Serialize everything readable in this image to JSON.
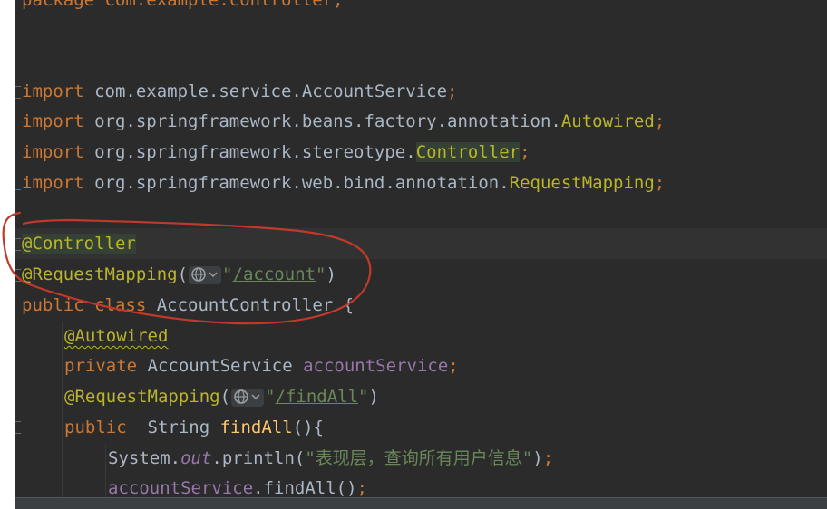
{
  "code": {
    "line_package": "package com.example.controller;",
    "import1": {
      "kw": "import",
      "path": " com.example.service.",
      "cls": "AccountService",
      "semi": ";"
    },
    "import2": {
      "kw": "import",
      "path": " org.springframework.beans.factory.annotation.",
      "cls": "Autowired",
      "semi": ";"
    },
    "import3": {
      "kw": "import",
      "path": " org.springframework.stereotype.",
      "cls": "Controller",
      "semi": ";"
    },
    "import4": {
      "kw": "import",
      "path": " org.springframework.web.bind.annotation.",
      "cls": "RequestMapping",
      "semi": ";"
    },
    "ann_controller": "@Controller",
    "ann_reqmap": "@RequestMapping",
    "paren_open": "(",
    "paren_close": ")",
    "quote": "\"",
    "url_account": "/account",
    "class_decl": {
      "public": "public",
      "class": "class",
      "name": " AccountController ",
      "brace": "{"
    },
    "ann_autowired": "@Autowired",
    "field_decl": {
      "private": "private",
      "type": " AccountService ",
      "name": "accountService",
      "semi": ";"
    },
    "url_findall": "/findAll",
    "method_decl": {
      "public": "public",
      "type": "  String ",
      "name": "findAll",
      "parens": "(){"
    },
    "println": {
      "obj": "System.",
      "field": "out",
      "call": ".println(",
      "str": "\"表现层，查询所有用户信息\"",
      "end": ")",
      "semi": ";"
    },
    "service_call": {
      "field": "accountService",
      "call": ".findAll()",
      "semi": ";"
    }
  },
  "icons": {
    "web": "globe-icon",
    "dropdown": "chevron-down-icon"
  },
  "colors": {
    "background": "#2b2b2b",
    "keyword": "#cc7832",
    "annotation": "#bbb529",
    "string": "#6a8759",
    "field": "#9876aa",
    "method": "#ffc66d",
    "text": "#a9b7c6",
    "annotation_circle": "#c0392b"
  }
}
